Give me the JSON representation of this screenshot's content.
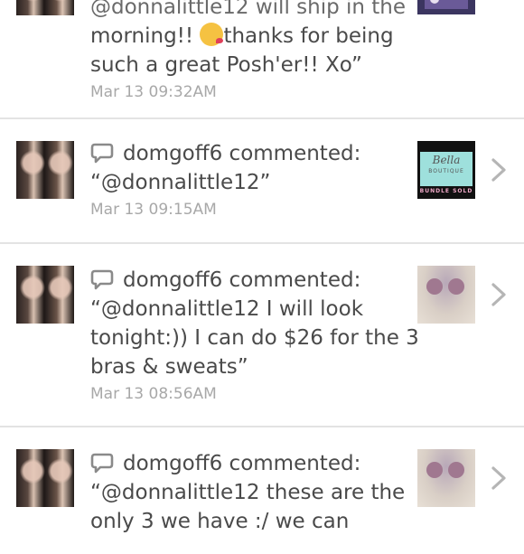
{
  "items": [
    {
      "text_line1": "@donnalittle12 will ship in the",
      "text_line2_pre": "morning!!",
      "emoji": "kissing-face-emoji",
      "text_line2_post": "thanks for being",
      "text_line3": "such a great Posh'er!! Xo”",
      "timestamp": "Mar 13 09:32AM",
      "thumb_icon": "listing-thumbnail"
    },
    {
      "user": "domgoff6",
      "action": "commented:",
      "comment_lines": [
        "“@donnalittle12”"
      ],
      "timestamp": "Mar 13 09:15AM",
      "thumb_text_top": "Bella",
      "thumb_text_mid": "BOUTIQUE",
      "thumb_text_bot": "BUNDLE SOLD"
    },
    {
      "user": "domgoff6",
      "action": "commented:",
      "comment_lines": [
        "“@donnalittle12 I will look",
        "tonight:)) I can do $26 for the 3",
        "bras & sweats”"
      ],
      "timestamp": "Mar 13 08:56AM"
    },
    {
      "user": "domgoff6",
      "action": "commented:",
      "comment_lines": [
        "“@donnalittle12 these are the",
        "only 3 we have :/ we can"
      ]
    }
  ],
  "colors": {
    "text": "#4a4a4a",
    "timestamp": "#a8a8a8",
    "divider": "#e3e3e3",
    "chevron": "#b5b5b5"
  }
}
